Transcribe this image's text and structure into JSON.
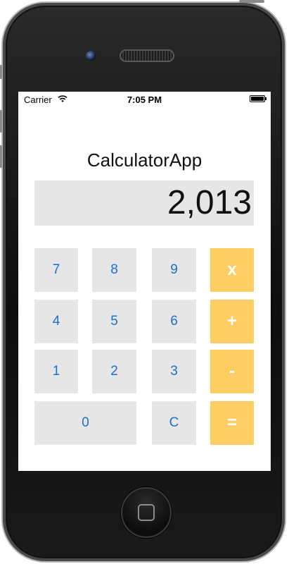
{
  "status_bar": {
    "carrier": "Carrier",
    "time": "7:05 PM"
  },
  "app": {
    "title": "CalculatorApp",
    "display_value": "2,013"
  },
  "keypad": {
    "row1": [
      "7",
      "8",
      "9",
      "x"
    ],
    "row2": [
      "4",
      "5",
      "6",
      "+"
    ],
    "row3": [
      "1",
      "2",
      "3",
      "-"
    ],
    "row4": [
      "0",
      "C",
      "="
    ]
  },
  "colors": {
    "digit_key_bg": "#e6e6e6",
    "digit_key_text": "#1a6fd0",
    "operator_key_bg": "#fecd63",
    "operator_key_text": "#ffffff",
    "display_bg": "#e6e6e6"
  },
  "icons": {
    "wifi": "wifi-icon",
    "battery": "battery-icon"
  }
}
